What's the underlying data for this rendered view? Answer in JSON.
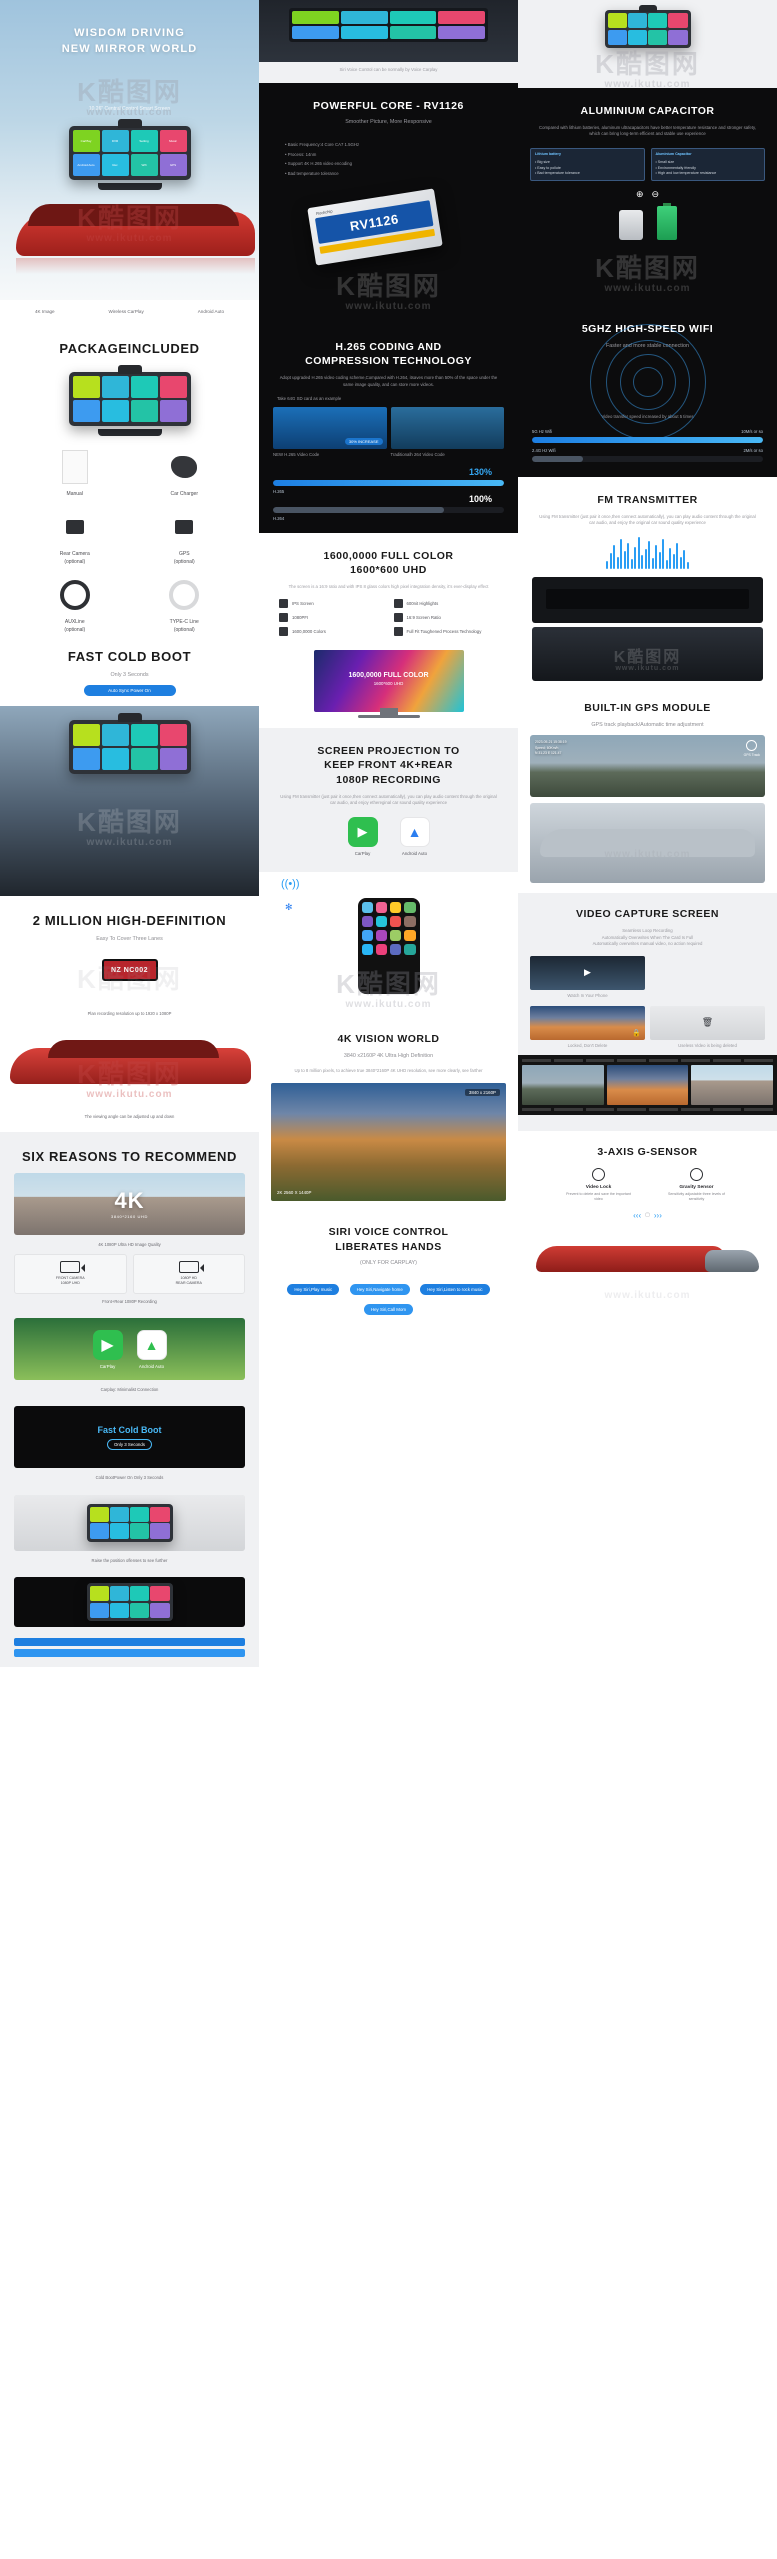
{
  "brand": {
    "watermark_k": "K酷图网",
    "watermark_url": "www.ikutu.com"
  },
  "col1": {
    "hero": {
      "title": "WISDOM DRIVING\nNEW MIRROR WORLD",
      "subtitle": "10.26\" Central Control Smart Screen",
      "features": [
        "4K Image",
        "Wireless CarPlay",
        "Android Auto"
      ],
      "tiles": [
        "CarPlay",
        "DVR",
        "Setting",
        "Music",
        "Android Auto",
        "Rec",
        "Wifi",
        "GPS"
      ]
    },
    "package": {
      "title": "PACKAGEINCLUDED",
      "items": [
        {
          "label": "Manual",
          "icon": "manual-icon"
        },
        {
          "label": "Car Charger",
          "icon": "charger-icon"
        },
        {
          "label": "Rear Camera\n(optional)",
          "icon": "rear-camera-icon"
        },
        {
          "label": "GPS\n(optional)",
          "icon": "gps-icon"
        },
        {
          "label": "AUXLine\n(optional)",
          "icon": "aux-line-icon"
        },
        {
          "label": "TYPE-C Line\n(optional)",
          "icon": "typec-line-icon"
        }
      ]
    },
    "coldboot": {
      "title": "FAST COLD BOOT",
      "subtitle": "Only 3 Seconds",
      "button": "Auto Sync Power On"
    },
    "twomillion": {
      "title": "2 MILLION HIGH-DEFINITION",
      "subtitle": "Easy To Cover Three Lanes",
      "plate": "NZ NC002",
      "caption": "Plan recording resolution up to 1920 x 1080P",
      "note": "The viewing angle can be adjusted up and down"
    },
    "reasons": {
      "title": "SIX REASONS TO RECOMMEND",
      "cards": [
        {
          "headline": "4K",
          "sub": "3840*2160 UHD",
          "caption": "4K 1080P Ultra HD Image Quality",
          "style": "img-road"
        },
        {
          "front": "FRONT CAMERA\n1080P UHD",
          "rear": "1080P HD\nREAR CAMERA",
          "caption": "Front+Rear 1080P Recording",
          "style": "dual-cam"
        },
        {
          "caption": "Carplay: Minimalist Connection",
          "style": "img-green",
          "apps": [
            "CarPlay",
            "Android Auto"
          ]
        },
        {
          "headline": "Fast Cold Boot",
          "sub": "Only 3 Seconds",
          "caption": "Cold BootPower On Only 3 Seconds",
          "style": "img-black"
        },
        {
          "caption": "Raise the position oflenses to see further",
          "style": "img-gray"
        }
      ]
    }
  },
  "col2": {
    "siri": {
      "caption": "Siri Voice Control can be normally by Voice Carplay"
    },
    "core": {
      "title": "POWERFUL CORE - RV1126",
      "subtitle": "Smoother Picture, More Responsive",
      "bullets": [
        "Basic Frequency:4 Core CA7 1.5GHz",
        "Process: 14nm",
        "Support 4K H.265 video encoding",
        "Bad temperature tolerance"
      ],
      "chip_brand": "Rockchip",
      "chip_model": "RV1126"
    },
    "h265": {
      "title": "H.265 CODING AND\nCOMPRESSION TECHNOLOGY",
      "subtitle": "Adopt upgraded H.265 video coding scheme,Compared with H.264, itsaves more than 50% of the space under the same image quality, and can store more videos.",
      "left_label": "Take 64G SD card as an example",
      "left_tag": "NEW H.265 Video Code",
      "right_tag": "Traditionalh 264 Video Code",
      "pct_label": "30% INCREASE",
      "bar1_value": "130%",
      "bar2_value": "100%",
      "bar1_name": "H.265",
      "bar2_name": "H.264"
    },
    "color": {
      "title": "1600,0000 FULL COLOR\n1600*600 UHD",
      "subtitle": "The screen  is a 16:9 ratio and with IPS 8 glass colors high pixel integration density, it's ever-display effect",
      "chips": [
        "IPS Screen",
        "600nit Highlights",
        "1080PFI",
        "16:9 Screen Ratio",
        "1600,0000 Colors",
        "Full Fit Toughened Process Technology"
      ],
      "monitor_title": "1600,0000 FULL COLOR",
      "monitor_sub": "1600*600 UHD"
    },
    "projection": {
      "title": "SCREEN PROJECTION TO\nKEEP FRONT 4K+REAR\n1080P RECORDING",
      "subtitle": "Using FM transmitter (just pair it once,then connect automatically), you can play audio content through the original car audio, and enjoy ethereginal car sound quality experience",
      "apps": [
        "CarPlay",
        "Android Auto"
      ]
    },
    "vision4k": {
      "title": "4K VISION WORLD",
      "subtitle": "3840 x2160P 4K Ultra High Definition",
      "body": "Up to 8 million pixels, to achieve true 3840*2160P 4K UHD resolution, see more clearly, see farther",
      "badge": "3840 x 2160P",
      "caption": "2K 2560 X 1440P"
    },
    "voice": {
      "title": "SIRI VOICE CONTROL\nLIBERATES HANDS",
      "subtitle": "(ONLY FOR CARPLAY)",
      "bubbles": [
        "Hey Siri,Play music",
        "Hey Siri,Navigate home",
        "Hey Siri,Listen to rock music",
        "Hey Siri,Call Mom"
      ]
    }
  },
  "col3": {
    "capacitor": {
      "title": "ALUMINIUM CAPACITOR",
      "subtitle": "Compared with lithium batteries, aluminum ultracapacitors have better temperature resistance and stronger safety, which can bring long-term efficient and stable use experience",
      "left_head": "Lithium battery",
      "left_items": [
        "Big size",
        "Easy to pollute",
        "Bad temperature tolerance"
      ],
      "right_head": "Aluminium Capacitor",
      "right_items": [
        "Small size",
        "Environmentally friendly",
        "High and low temperature resistance"
      ]
    },
    "wifi": {
      "title": "5GHZ HIGH-SPEED WIFI",
      "subtitle": "Faster and more stable connection",
      "note": "Video transfer speed increased by about 5 times",
      "rows": [
        {
          "name": "5G Hz Wifi",
          "value": "10M/s or so",
          "pct": 100
        },
        {
          "name": "2.4G Hz Wifi",
          "value": "2M/s or so",
          "pct": 22
        }
      ]
    },
    "fm": {
      "title": "FM TRANSMITTER",
      "subtitle": "Using FM transmitter (just pair it once,then connect automatically), you can play audio content through the original car audio, and enjoy the original car sound quality experience"
    },
    "gps": {
      "title": "BUILT-IN GPS MODULE",
      "subtitle": "GPS track playback/Automatic time adjustment",
      "overlay": [
        "2023-05-21 15:38:19",
        "Speed: 60Km/h",
        "N 31.23 E 121.47"
      ],
      "badge": "GPS Track"
    },
    "capture": {
      "title": "VIDEO CAPTURE SCREEN",
      "lines": [
        "Seamless Loop Recording",
        "Automatically Overwrites When The Card Is Full",
        "Automatically overwrites manual video, no action required"
      ],
      "cards": [
        {
          "label": "Watch In Your Phone",
          "style": "img-city"
        },
        {
          "label": "Locked, Don't Delete",
          "style": "img-sunset"
        },
        {
          "label": "Useless Video is being deleted",
          "style": "img-gray"
        }
      ]
    },
    "gsensor": {
      "title": "3-AXIS G-SENSOR",
      "items": [
        {
          "name": "Video Lock",
          "desc": "Prevent to delete and save the important video",
          "icon": "lock-icon"
        },
        {
          "name": "Gravity Sensor",
          "desc": "Sensitivity adjustable three levels of sensitivity",
          "icon": "gravity-icon"
        }
      ]
    }
  }
}
